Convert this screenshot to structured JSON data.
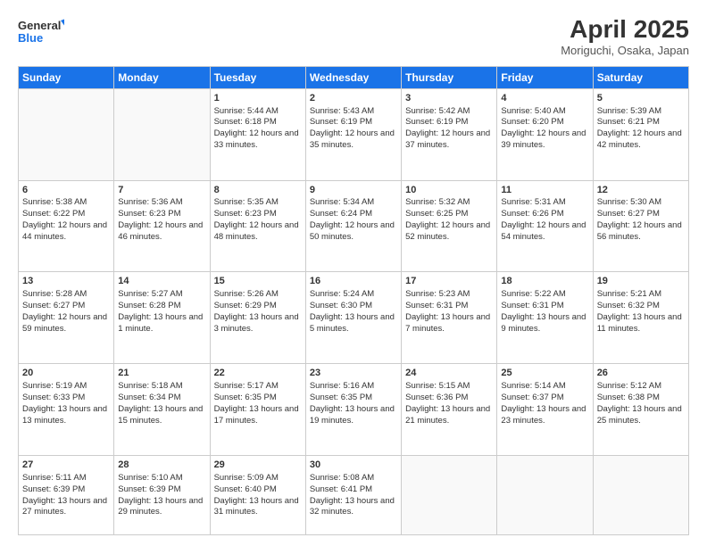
{
  "logo": {
    "line1": "General",
    "line2": "Blue"
  },
  "header": {
    "title": "April 2025",
    "subtitle": "Moriguchi, Osaka, Japan"
  },
  "weekdays": [
    "Sunday",
    "Monday",
    "Tuesday",
    "Wednesday",
    "Thursday",
    "Friday",
    "Saturday"
  ],
  "weeks": [
    [
      {
        "day": "",
        "content": ""
      },
      {
        "day": "",
        "content": ""
      },
      {
        "day": "1",
        "content": "Sunrise: 5:44 AM\nSunset: 6:18 PM\nDaylight: 12 hours and 33 minutes."
      },
      {
        "day": "2",
        "content": "Sunrise: 5:43 AM\nSunset: 6:19 PM\nDaylight: 12 hours and 35 minutes."
      },
      {
        "day": "3",
        "content": "Sunrise: 5:42 AM\nSunset: 6:19 PM\nDaylight: 12 hours and 37 minutes."
      },
      {
        "day": "4",
        "content": "Sunrise: 5:40 AM\nSunset: 6:20 PM\nDaylight: 12 hours and 39 minutes."
      },
      {
        "day": "5",
        "content": "Sunrise: 5:39 AM\nSunset: 6:21 PM\nDaylight: 12 hours and 42 minutes."
      }
    ],
    [
      {
        "day": "6",
        "content": "Sunrise: 5:38 AM\nSunset: 6:22 PM\nDaylight: 12 hours and 44 minutes."
      },
      {
        "day": "7",
        "content": "Sunrise: 5:36 AM\nSunset: 6:23 PM\nDaylight: 12 hours and 46 minutes."
      },
      {
        "day": "8",
        "content": "Sunrise: 5:35 AM\nSunset: 6:23 PM\nDaylight: 12 hours and 48 minutes."
      },
      {
        "day": "9",
        "content": "Sunrise: 5:34 AM\nSunset: 6:24 PM\nDaylight: 12 hours and 50 minutes."
      },
      {
        "day": "10",
        "content": "Sunrise: 5:32 AM\nSunset: 6:25 PM\nDaylight: 12 hours and 52 minutes."
      },
      {
        "day": "11",
        "content": "Sunrise: 5:31 AM\nSunset: 6:26 PM\nDaylight: 12 hours and 54 minutes."
      },
      {
        "day": "12",
        "content": "Sunrise: 5:30 AM\nSunset: 6:27 PM\nDaylight: 12 hours and 56 minutes."
      }
    ],
    [
      {
        "day": "13",
        "content": "Sunrise: 5:28 AM\nSunset: 6:27 PM\nDaylight: 12 hours and 59 minutes."
      },
      {
        "day": "14",
        "content": "Sunrise: 5:27 AM\nSunset: 6:28 PM\nDaylight: 13 hours and 1 minute."
      },
      {
        "day": "15",
        "content": "Sunrise: 5:26 AM\nSunset: 6:29 PM\nDaylight: 13 hours and 3 minutes."
      },
      {
        "day": "16",
        "content": "Sunrise: 5:24 AM\nSunset: 6:30 PM\nDaylight: 13 hours and 5 minutes."
      },
      {
        "day": "17",
        "content": "Sunrise: 5:23 AM\nSunset: 6:31 PM\nDaylight: 13 hours and 7 minutes."
      },
      {
        "day": "18",
        "content": "Sunrise: 5:22 AM\nSunset: 6:31 PM\nDaylight: 13 hours and 9 minutes."
      },
      {
        "day": "19",
        "content": "Sunrise: 5:21 AM\nSunset: 6:32 PM\nDaylight: 13 hours and 11 minutes."
      }
    ],
    [
      {
        "day": "20",
        "content": "Sunrise: 5:19 AM\nSunset: 6:33 PM\nDaylight: 13 hours and 13 minutes."
      },
      {
        "day": "21",
        "content": "Sunrise: 5:18 AM\nSunset: 6:34 PM\nDaylight: 13 hours and 15 minutes."
      },
      {
        "day": "22",
        "content": "Sunrise: 5:17 AM\nSunset: 6:35 PM\nDaylight: 13 hours and 17 minutes."
      },
      {
        "day": "23",
        "content": "Sunrise: 5:16 AM\nSunset: 6:35 PM\nDaylight: 13 hours and 19 minutes."
      },
      {
        "day": "24",
        "content": "Sunrise: 5:15 AM\nSunset: 6:36 PM\nDaylight: 13 hours and 21 minutes."
      },
      {
        "day": "25",
        "content": "Sunrise: 5:14 AM\nSunset: 6:37 PM\nDaylight: 13 hours and 23 minutes."
      },
      {
        "day": "26",
        "content": "Sunrise: 5:12 AM\nSunset: 6:38 PM\nDaylight: 13 hours and 25 minutes."
      }
    ],
    [
      {
        "day": "27",
        "content": "Sunrise: 5:11 AM\nSunset: 6:39 PM\nDaylight: 13 hours and 27 minutes."
      },
      {
        "day": "28",
        "content": "Sunrise: 5:10 AM\nSunset: 6:39 PM\nDaylight: 13 hours and 29 minutes."
      },
      {
        "day": "29",
        "content": "Sunrise: 5:09 AM\nSunset: 6:40 PM\nDaylight: 13 hours and 31 minutes."
      },
      {
        "day": "30",
        "content": "Sunrise: 5:08 AM\nSunset: 6:41 PM\nDaylight: 13 hours and 32 minutes."
      },
      {
        "day": "",
        "content": ""
      },
      {
        "day": "",
        "content": ""
      },
      {
        "day": "",
        "content": ""
      }
    ]
  ]
}
